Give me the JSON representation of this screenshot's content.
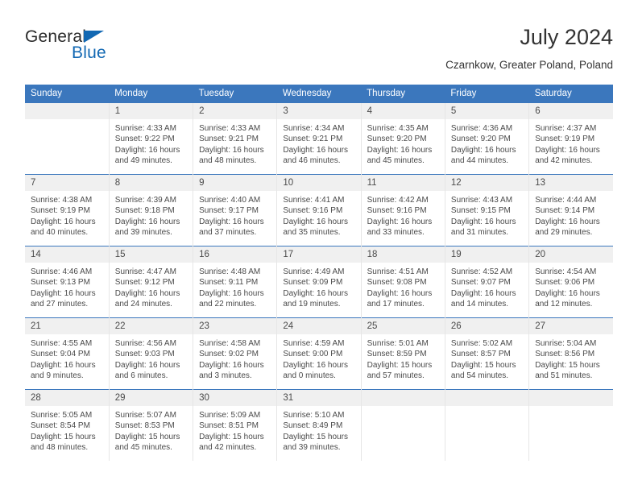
{
  "logo": {
    "word1": "General",
    "word2": "Blue",
    "triangle_color": "#1268b3"
  },
  "header": {
    "title": "July 2024",
    "subtitle": "Czarnkow, Greater Poland, Poland"
  },
  "theme": {
    "header_row_bg": "#3b77bd",
    "daynum_bg": "#f0f0f0",
    "text_color": "#4a4a4a"
  },
  "calendar": {
    "weekday_headers": [
      "Sunday",
      "Monday",
      "Tuesday",
      "Wednesday",
      "Thursday",
      "Friday",
      "Saturday"
    ],
    "weeks": [
      [
        {
          "day": "",
          "sunrise": "",
          "sunset": "",
          "daylight1": "",
          "daylight2": ""
        },
        {
          "day": "1",
          "sunrise": "Sunrise: 4:33 AM",
          "sunset": "Sunset: 9:22 PM",
          "daylight1": "Daylight: 16 hours",
          "daylight2": "and 49 minutes."
        },
        {
          "day": "2",
          "sunrise": "Sunrise: 4:33 AM",
          "sunset": "Sunset: 9:21 PM",
          "daylight1": "Daylight: 16 hours",
          "daylight2": "and 48 minutes."
        },
        {
          "day": "3",
          "sunrise": "Sunrise: 4:34 AM",
          "sunset": "Sunset: 9:21 PM",
          "daylight1": "Daylight: 16 hours",
          "daylight2": "and 46 minutes."
        },
        {
          "day": "4",
          "sunrise": "Sunrise: 4:35 AM",
          "sunset": "Sunset: 9:20 PM",
          "daylight1": "Daylight: 16 hours",
          "daylight2": "and 45 minutes."
        },
        {
          "day": "5",
          "sunrise": "Sunrise: 4:36 AM",
          "sunset": "Sunset: 9:20 PM",
          "daylight1": "Daylight: 16 hours",
          "daylight2": "and 44 minutes."
        },
        {
          "day": "6",
          "sunrise": "Sunrise: 4:37 AM",
          "sunset": "Sunset: 9:19 PM",
          "daylight1": "Daylight: 16 hours",
          "daylight2": "and 42 minutes."
        }
      ],
      [
        {
          "day": "7",
          "sunrise": "Sunrise: 4:38 AM",
          "sunset": "Sunset: 9:19 PM",
          "daylight1": "Daylight: 16 hours",
          "daylight2": "and 40 minutes."
        },
        {
          "day": "8",
          "sunrise": "Sunrise: 4:39 AM",
          "sunset": "Sunset: 9:18 PM",
          "daylight1": "Daylight: 16 hours",
          "daylight2": "and 39 minutes."
        },
        {
          "day": "9",
          "sunrise": "Sunrise: 4:40 AM",
          "sunset": "Sunset: 9:17 PM",
          "daylight1": "Daylight: 16 hours",
          "daylight2": "and 37 minutes."
        },
        {
          "day": "10",
          "sunrise": "Sunrise: 4:41 AM",
          "sunset": "Sunset: 9:16 PM",
          "daylight1": "Daylight: 16 hours",
          "daylight2": "and 35 minutes."
        },
        {
          "day": "11",
          "sunrise": "Sunrise: 4:42 AM",
          "sunset": "Sunset: 9:16 PM",
          "daylight1": "Daylight: 16 hours",
          "daylight2": "and 33 minutes."
        },
        {
          "day": "12",
          "sunrise": "Sunrise: 4:43 AM",
          "sunset": "Sunset: 9:15 PM",
          "daylight1": "Daylight: 16 hours",
          "daylight2": "and 31 minutes."
        },
        {
          "day": "13",
          "sunrise": "Sunrise: 4:44 AM",
          "sunset": "Sunset: 9:14 PM",
          "daylight1": "Daylight: 16 hours",
          "daylight2": "and 29 minutes."
        }
      ],
      [
        {
          "day": "14",
          "sunrise": "Sunrise: 4:46 AM",
          "sunset": "Sunset: 9:13 PM",
          "daylight1": "Daylight: 16 hours",
          "daylight2": "and 27 minutes."
        },
        {
          "day": "15",
          "sunrise": "Sunrise: 4:47 AM",
          "sunset": "Sunset: 9:12 PM",
          "daylight1": "Daylight: 16 hours",
          "daylight2": "and 24 minutes."
        },
        {
          "day": "16",
          "sunrise": "Sunrise: 4:48 AM",
          "sunset": "Sunset: 9:11 PM",
          "daylight1": "Daylight: 16 hours",
          "daylight2": "and 22 minutes."
        },
        {
          "day": "17",
          "sunrise": "Sunrise: 4:49 AM",
          "sunset": "Sunset: 9:09 PM",
          "daylight1": "Daylight: 16 hours",
          "daylight2": "and 19 minutes."
        },
        {
          "day": "18",
          "sunrise": "Sunrise: 4:51 AM",
          "sunset": "Sunset: 9:08 PM",
          "daylight1": "Daylight: 16 hours",
          "daylight2": "and 17 minutes."
        },
        {
          "day": "19",
          "sunrise": "Sunrise: 4:52 AM",
          "sunset": "Sunset: 9:07 PM",
          "daylight1": "Daylight: 16 hours",
          "daylight2": "and 14 minutes."
        },
        {
          "day": "20",
          "sunrise": "Sunrise: 4:54 AM",
          "sunset": "Sunset: 9:06 PM",
          "daylight1": "Daylight: 16 hours",
          "daylight2": "and 12 minutes."
        }
      ],
      [
        {
          "day": "21",
          "sunrise": "Sunrise: 4:55 AM",
          "sunset": "Sunset: 9:04 PM",
          "daylight1": "Daylight: 16 hours",
          "daylight2": "and 9 minutes."
        },
        {
          "day": "22",
          "sunrise": "Sunrise: 4:56 AM",
          "sunset": "Sunset: 9:03 PM",
          "daylight1": "Daylight: 16 hours",
          "daylight2": "and 6 minutes."
        },
        {
          "day": "23",
          "sunrise": "Sunrise: 4:58 AM",
          "sunset": "Sunset: 9:02 PM",
          "daylight1": "Daylight: 16 hours",
          "daylight2": "and 3 minutes."
        },
        {
          "day": "24",
          "sunrise": "Sunrise: 4:59 AM",
          "sunset": "Sunset: 9:00 PM",
          "daylight1": "Daylight: 16 hours",
          "daylight2": "and 0 minutes."
        },
        {
          "day": "25",
          "sunrise": "Sunrise: 5:01 AM",
          "sunset": "Sunset: 8:59 PM",
          "daylight1": "Daylight: 15 hours",
          "daylight2": "and 57 minutes."
        },
        {
          "day": "26",
          "sunrise": "Sunrise: 5:02 AM",
          "sunset": "Sunset: 8:57 PM",
          "daylight1": "Daylight: 15 hours",
          "daylight2": "and 54 minutes."
        },
        {
          "day": "27",
          "sunrise": "Sunrise: 5:04 AM",
          "sunset": "Sunset: 8:56 PM",
          "daylight1": "Daylight: 15 hours",
          "daylight2": "and 51 minutes."
        }
      ],
      [
        {
          "day": "28",
          "sunrise": "Sunrise: 5:05 AM",
          "sunset": "Sunset: 8:54 PM",
          "daylight1": "Daylight: 15 hours",
          "daylight2": "and 48 minutes."
        },
        {
          "day": "29",
          "sunrise": "Sunrise: 5:07 AM",
          "sunset": "Sunset: 8:53 PM",
          "daylight1": "Daylight: 15 hours",
          "daylight2": "and 45 minutes."
        },
        {
          "day": "30",
          "sunrise": "Sunrise: 5:09 AM",
          "sunset": "Sunset: 8:51 PM",
          "daylight1": "Daylight: 15 hours",
          "daylight2": "and 42 minutes."
        },
        {
          "day": "31",
          "sunrise": "Sunrise: 5:10 AM",
          "sunset": "Sunset: 8:49 PM",
          "daylight1": "Daylight: 15 hours",
          "daylight2": "and 39 minutes."
        },
        {
          "day": "",
          "sunrise": "",
          "sunset": "",
          "daylight1": "",
          "daylight2": ""
        },
        {
          "day": "",
          "sunrise": "",
          "sunset": "",
          "daylight1": "",
          "daylight2": ""
        },
        {
          "day": "",
          "sunrise": "",
          "sunset": "",
          "daylight1": "",
          "daylight2": ""
        }
      ]
    ]
  }
}
